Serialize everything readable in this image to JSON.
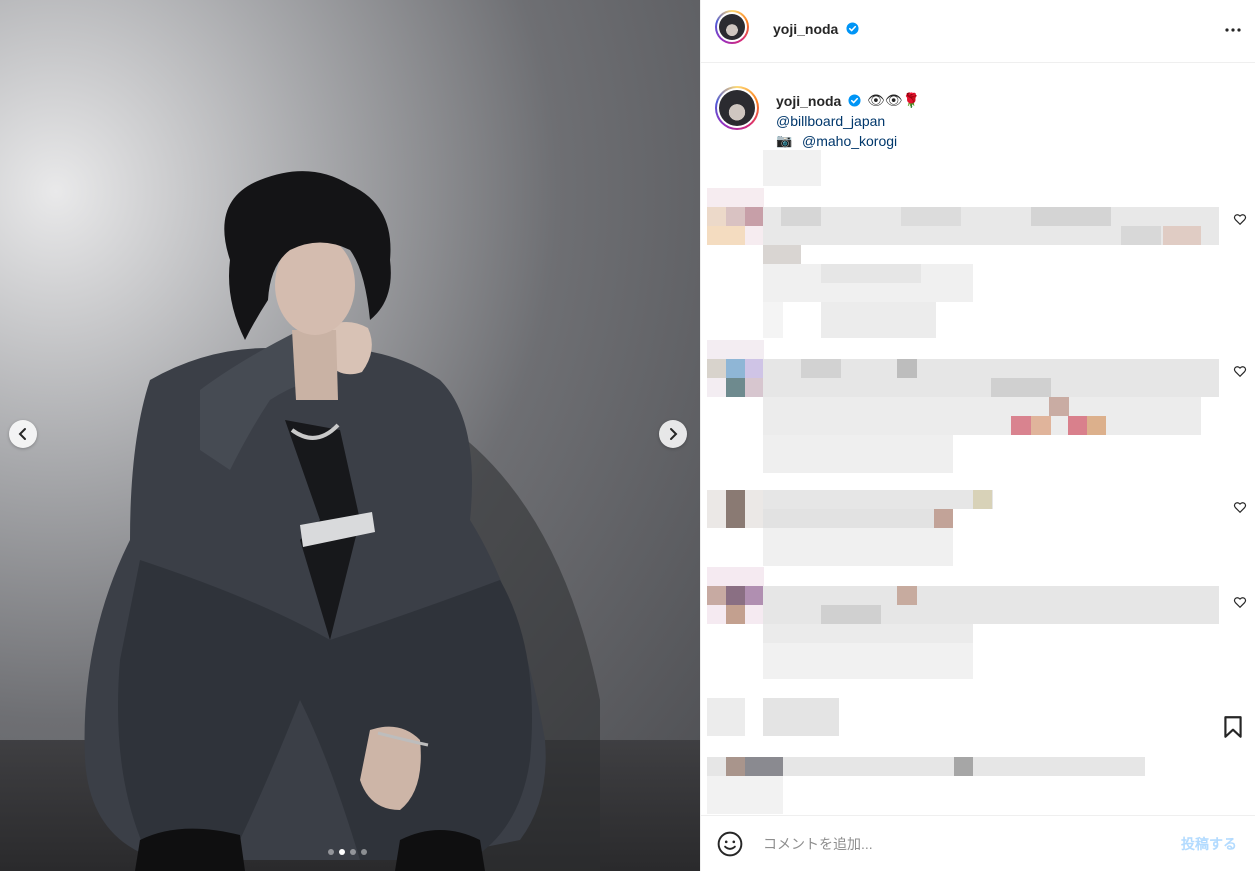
{
  "post": {
    "username": "yoji_noda",
    "verified_icon": "verified-badge-icon",
    "more_icon": "more-options-icon",
    "caption_emojis": "👁👁🌹",
    "mention_1": "@billboard_japan",
    "camera_glyph": "📷",
    "mention_2": "@maho_korogi"
  },
  "media": {
    "carousel_count": 4,
    "active_index": 1
  },
  "comment_box": {
    "placeholder": "コメントを追加...",
    "post_label": "投稿する"
  },
  "colors": {
    "link": "#00376b",
    "post_button_disabled": "#b3dbff",
    "verified": "#0095f6"
  }
}
